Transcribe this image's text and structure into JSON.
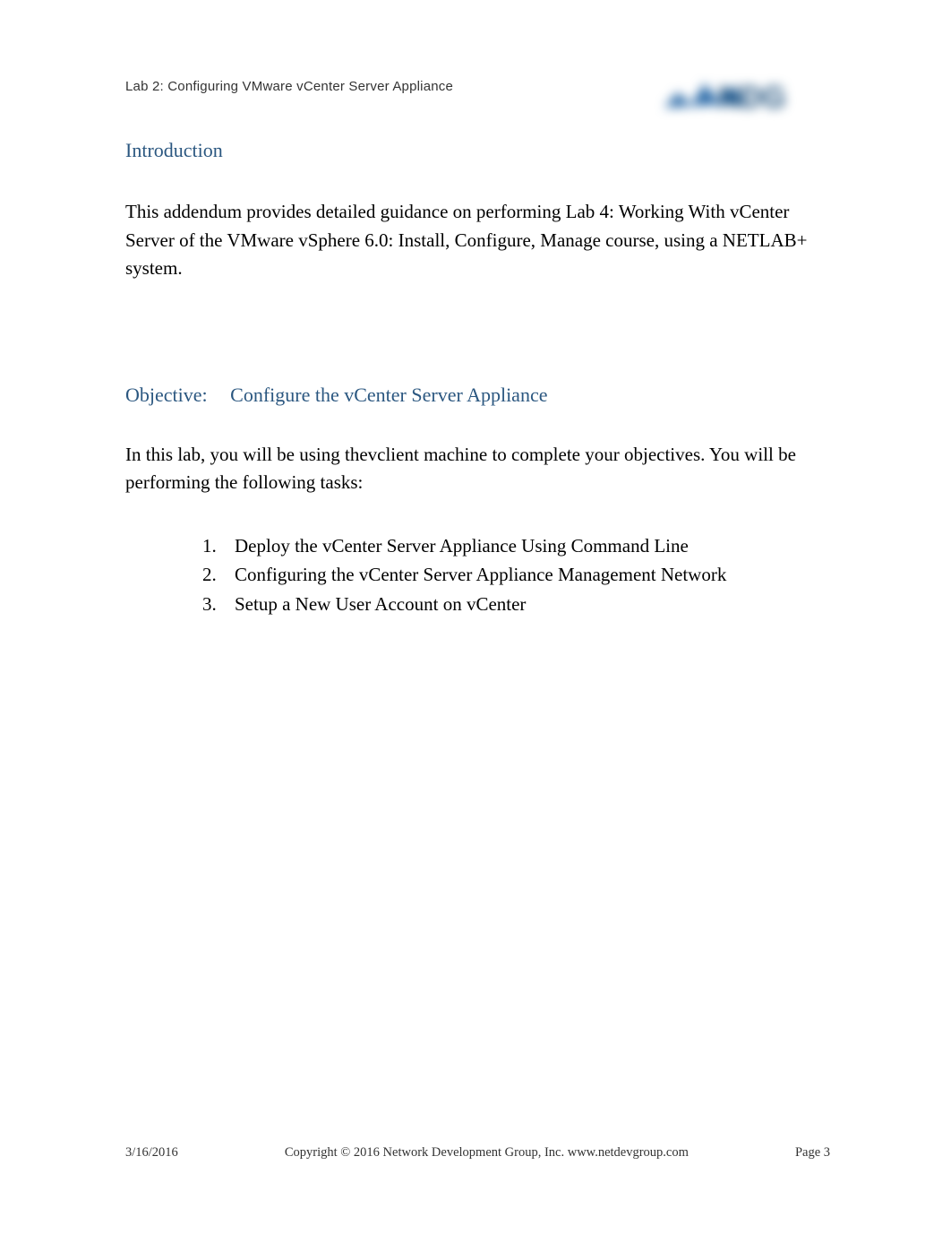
{
  "header": {
    "lab_label": "Lab 2:  Configuring VMware vCenter Server Appliance"
  },
  "logo": {
    "name": "ndg-logo"
  },
  "sections": {
    "intro_heading": "Introduction",
    "intro_para_part1": "This addendum provides detailed guidance on performing   Lab 4: Working With vCenter Server",
    "intro_para_part2": "of the",
    "intro_para_part3": "VMware vSphere 6.0: Install, Configure, Manage",
    "intro_para_part4": "course, using a NETLAB+ system.",
    "objective_label": "Objective:",
    "objective_text": "Configure the vCenter Server Appliance",
    "obj_para_part1": "In this lab, you will be using the",
    "obj_para_part2": "vclient",
    "obj_para_part3": "machine to complete your objectives.   You will be performing the following tasks:",
    "tasks": [
      {
        "num": "1.",
        "text": "Deploy the vCenter Server Appliance Using Command Line"
      },
      {
        "num": "2.",
        "text": "Configuring the vCenter Server Appliance Management Network"
      },
      {
        "num": "3.",
        "text": "Setup a New User Account on vCenter"
      }
    ]
  },
  "footer": {
    "date": "3/16/2016",
    "copyright": "Copyright © 2016 Network Development Group, Inc. www.netdevgroup.com",
    "page": "Page 3"
  }
}
